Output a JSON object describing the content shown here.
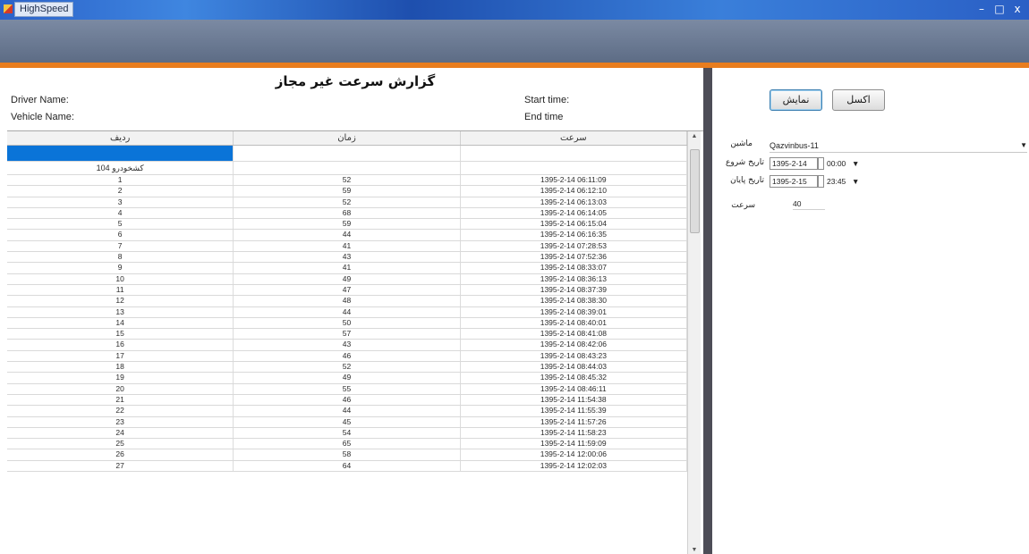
{
  "window": {
    "title": "HighSpeed",
    "controls": [
      "–",
      "□",
      "x"
    ]
  },
  "report": {
    "title": "گزارش سرعت غیر مجاز",
    "driver_name_label": "Driver Name:",
    "vehicle_name_label": "Vehicle Name:",
    "start_time_label": "Start time:",
    "end_time_label": "End time",
    "columns": [
      "ردیف",
      "زمان",
      "سرعت"
    ],
    "group_label": "کشخودرو 104",
    "rows": [
      {
        "num": "1",
        "speed": "52",
        "time": "1395-2-14  06:11:09"
      },
      {
        "num": "2",
        "speed": "59",
        "time": "1395-2-14  06:12:10"
      },
      {
        "num": "3",
        "speed": "52",
        "time": "1395-2-14  06:13:03"
      },
      {
        "num": "4",
        "speed": "68",
        "time": "1395-2-14  06:14:05"
      },
      {
        "num": "5",
        "speed": "59",
        "time": "1395-2-14  06:15:04"
      },
      {
        "num": "6",
        "speed": "44",
        "time": "1395-2-14  06:16:35"
      },
      {
        "num": "7",
        "speed": "41",
        "time": "1395-2-14  07:28:53"
      },
      {
        "num": "8",
        "speed": "43",
        "time": "1395-2-14  07:52:36"
      },
      {
        "num": "9",
        "speed": "41",
        "time": "1395-2-14  08:33:07"
      },
      {
        "num": "10",
        "speed": "49",
        "time": "1395-2-14  08:36:13"
      },
      {
        "num": "11",
        "speed": "47",
        "time": "1395-2-14  08:37:39"
      },
      {
        "num": "12",
        "speed": "48",
        "time": "1395-2-14  08:38:30"
      },
      {
        "num": "13",
        "speed": "44",
        "time": "1395-2-14  08:39:01"
      },
      {
        "num": "14",
        "speed": "50",
        "time": "1395-2-14  08:40:01"
      },
      {
        "num": "15",
        "speed": "57",
        "time": "1395-2-14  08:41:08"
      },
      {
        "num": "16",
        "speed": "43",
        "time": "1395-2-14  08:42:06"
      },
      {
        "num": "17",
        "speed": "46",
        "time": "1395-2-14  08:43:23"
      },
      {
        "num": "18",
        "speed": "52",
        "time": "1395-2-14  08:44:03"
      },
      {
        "num": "19",
        "speed": "49",
        "time": "1395-2-14  08:45:32"
      },
      {
        "num": "20",
        "speed": "55",
        "time": "1395-2-14  08:46:11"
      },
      {
        "num": "21",
        "speed": "46",
        "time": "1395-2-14  11:54:38"
      },
      {
        "num": "22",
        "speed": "44",
        "time": "1395-2-14  11:55:39"
      },
      {
        "num": "23",
        "speed": "45",
        "time": "1395-2-14  11:57:26"
      },
      {
        "num": "24",
        "speed": "54",
        "time": "1395-2-14  11:58:23"
      },
      {
        "num": "25",
        "speed": "65",
        "time": "1395-2-14  11:59:09"
      },
      {
        "num": "26",
        "speed": "58",
        "time": "1395-2-14  12:00:06"
      },
      {
        "num": "27",
        "speed": "64",
        "time": "1395-2-14  12:02:03"
      }
    ]
  },
  "filters": {
    "excel_button": "اکسل",
    "show_button": "نمایش",
    "vehicle_label": "ماشین",
    "vehicle_value": "Qazvinbus-11",
    "start_date_label": "تاریخ شروع",
    "start_date_value": "1395-2-14",
    "start_time_value": "00:00",
    "end_date_label": "تاریخ پایان",
    "end_date_value": "1395-2-15",
    "end_time_value": "23:45",
    "speed_label": "سرعت",
    "speed_value": "40"
  },
  "colors": {
    "selection": "#0a74d8",
    "accent_stripe": "#e87d1e",
    "header_band": "#66758e"
  }
}
